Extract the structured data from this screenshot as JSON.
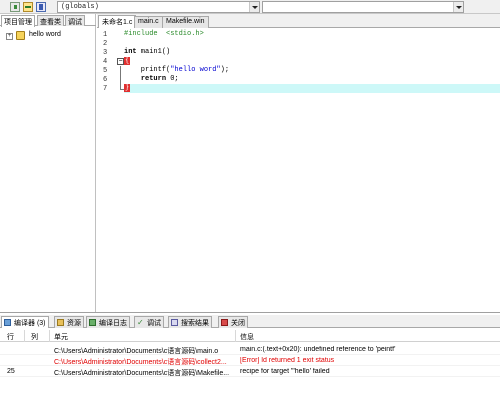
{
  "toolbar": {
    "combo_globals": "(globals)",
    "combo_second": ""
  },
  "left_panel": {
    "tabs": [
      "项目管理",
      "查看类",
      "调试"
    ],
    "tree": [
      {
        "label": "hello word",
        "toggle": "+"
      }
    ]
  },
  "editor": {
    "tabs": [
      "未命名1.c",
      "main.c",
      "Makefile.win"
    ],
    "line_numbers": [
      "1",
      "2",
      "3",
      "4",
      "5",
      "6",
      "7"
    ],
    "fold_marker": "−"
  },
  "bottom": {
    "tabs": [
      "编译器 (3)",
      "资源",
      "编译日志",
      "调试",
      "搜索结果",
      "关闭"
    ],
    "columns": [
      "行",
      "列",
      "单元",
      "信息"
    ],
    "rows": [
      {
        "line": "",
        "col": "",
        "unit": "C:\\Users\\Administrator\\Documents\\c语言源码\\main.o",
        "info": "main.c:(.text+0x20): undefined reference to 'peintf'",
        "error": false
      },
      {
        "line": "",
        "col": "",
        "unit": "C:\\Users\\Administrator\\Documents\\c语言源码\\collect2...",
        "info": "[Error] ld returned 1 exit status",
        "error": true
      },
      {
        "line": "25",
        "col": "",
        "unit": "C:\\Users\\Administrator\\Documents\\c语言源码\\Makefile...",
        "info": "recipe for target '\"hello' failed",
        "error": false
      }
    ]
  },
  "colors": {
    "current_line": "#cdf8f8",
    "error_text": "#e00000",
    "keyword": "#000000",
    "preprocessor": "#2a8a2a",
    "string": "#0000d0"
  }
}
